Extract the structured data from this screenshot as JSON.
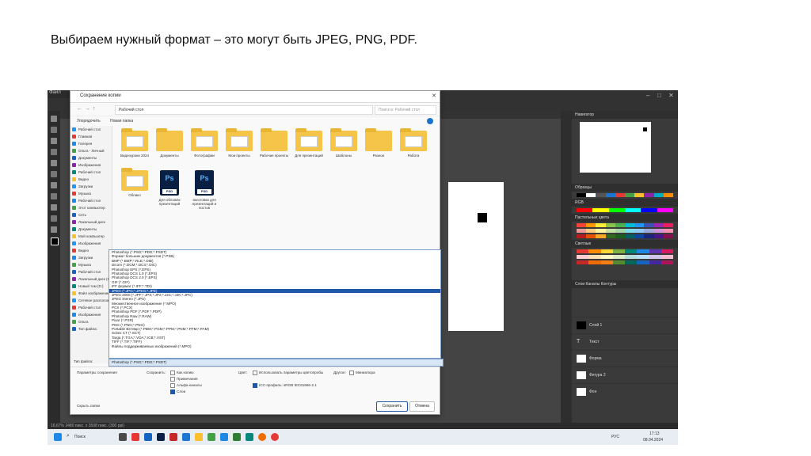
{
  "slide": {
    "caption": "Выбираем нужный формат – это могут быть JPEG, PNG, PDF."
  },
  "photoshop": {
    "tab_label": "Файл",
    "navigator_title": "Навигатор",
    "swatches_title": "Образцы",
    "swatch_groups": [
      "RGB",
      "Пастельные цвета",
      "Светлые",
      "Темные"
    ],
    "layers_title": "Слои",
    "layers_tabs": "Слои   Каналы   Контуры",
    "layers": [
      {
        "name": "Слой 1",
        "thumb": "#000000"
      },
      {
        "name": "Текст",
        "thumb": "text"
      },
      {
        "name": "Форма",
        "thumb": "#ffffff"
      },
      {
        "name": "Фигура 2",
        "thumb": "#ffffff"
      },
      {
        "name": "Фон",
        "thumb": "#ffffff"
      }
    ],
    "status_text": "16,67%   2480 пикс. x 3508 пикс. (300 ppi)"
  },
  "taskbar": {
    "search_label": "Поиск",
    "time": "17:13",
    "date": "08.04.2024",
    "lang": "РУС"
  },
  "dialog": {
    "title": "Сохранение копии",
    "address": "Рабочий стол",
    "search_placeholder": "Поиск в: Рабочий стол",
    "organize": "Упорядочить",
    "new_folder": "Новая папка",
    "nav_items": [
      "Рабочий стол",
      "Главная",
      "Галерея",
      "Ольга - Личный",
      "Документы",
      "Изображения",
      "Рабочий стол",
      "Видео",
      "Загрузки",
      "Музыка",
      "Рабочий стол",
      "Этот компьютер",
      "Сеть",
      "Локальный диск",
      "Документы",
      "Мой компьютер",
      "Изображения",
      "Видео",
      "Загрузки",
      "Музыка",
      "Рабочий стол",
      "Локальный диск (C:)",
      "Новый том (D:)",
      "Файл изображения",
      "Сетевое расположение",
      "Рабочий стол",
      "Изображения",
      "Ольга",
      "Тип файла:"
    ],
    "files": [
      {
        "label": "Видеоуроки 2024",
        "kind": "folder"
      },
      {
        "label": "Документы",
        "kind": "folder"
      },
      {
        "label": "Фотографии",
        "kind": "folder"
      },
      {
        "label": "Мои проекты",
        "kind": "folder"
      },
      {
        "label": "Рабочие проекты",
        "kind": "folder"
      },
      {
        "label": "Для презентаций",
        "kind": "folder"
      },
      {
        "label": "Шаблоны",
        "kind": "folder"
      },
      {
        "label": "Разное",
        "kind": "folder"
      },
      {
        "label": "Работа",
        "kind": "folder"
      },
      {
        "label": "Облако",
        "kind": "folder"
      },
      {
        "label": "Для обложек презентаций",
        "kind": "psd"
      },
      {
        "label": "Заготовки для презентаций и постов",
        "kind": "psd"
      }
    ],
    "formats": [
      "Photoshop (*.PSD;*.PDD;*.PSDT)",
      "Формат больших документов (*.PSB)",
      "BMP (*.BMP;*.RLE;*.DIB)",
      "Dicom (*.DCM;*.DC3;*.DIC)",
      "Photoshop EPS (*.EPS)",
      "Photoshop DCS 1.0 (*.EPS)",
      "Photoshop DCS 2.0 (*.EPS)",
      "GIF (*.GIF)",
      "IFF формат (*.IFF;*.TDI)",
      "JPEG (*.JPG;*.JPEG;*.JPE)",
      "JPEG 2000 (*.JPF;*.JPX;*.JP2;*.J2C;*.J2K;*.JPC)",
      "JPEG Stereo (*.JPS)",
      "Множественное изображение (*.MPO)",
      "PCX (*.PCX)",
      "Photoshop PDF (*.PDF;*.PDP)",
      "Photoshop Raw (*.RAW)",
      "Pixar (*.PXR)",
      "PNG (*.PNG;*.PNG)",
      "Portable Bit Map (*.PBM;*.PGM;*.PPM;*.PNM;*.PFM;*.PAM)",
      "Scitex CT (*.SCT)",
      "Targa (*.TGA;*.VDA;*.ICB;*.VST)",
      "TIFF (*.TIF;*.TIFF)",
      "Файлы поддерживаемых изображений (*.MPO)"
    ],
    "selected_format_index": 9,
    "filename_label": "Имя файла:",
    "type_label": "Тип файла:",
    "type_value": "Photoshop (*.PSD;*.PDD;*.PSDT)",
    "save_params": "Параметры сохранения",
    "save_label": "Сохранить:",
    "opt_copy": "Как копию",
    "opt_notes": "Примечания",
    "opt_alpha": "Альфа-каналы",
    "opt_spot": "Плашечные цвета",
    "opt_layers": "Слои",
    "color_label": "Цвет:",
    "opt_proof": "Использовать параметры цветопробы",
    "opt_icc": "ICC-профиль: sRGB IEC61966-2.1",
    "other_label": "Другое:",
    "opt_thumb": "Миниатюра",
    "hide_folders": "Скрыть папки",
    "save_button": "Сохранить",
    "cancel_button": "Отмена"
  },
  "colors": {
    "ps_bg": "#3c3c3c",
    "accent": "#1e56a8",
    "folder": "#f5c54a",
    "psd": "#0a1f44"
  }
}
